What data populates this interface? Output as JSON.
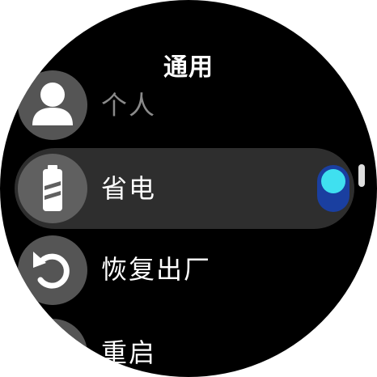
{
  "header": {
    "title": "通用"
  },
  "menu": {
    "items": [
      {
        "label": "个人",
        "icon": "person-icon"
      },
      {
        "label": "省电",
        "icon": "battery-icon",
        "toggle": {
          "state": "on"
        }
      },
      {
        "label": "恢复出厂",
        "icon": "restore-icon"
      },
      {
        "label": "重启",
        "icon": "restart-icon"
      }
    ]
  },
  "colors": {
    "background": "#000000",
    "selected_row": "#2e2e2e",
    "icon_circle": "#555555",
    "toggle_track": "#1a3fa0",
    "toggle_knob": "#3fe0f0"
  }
}
